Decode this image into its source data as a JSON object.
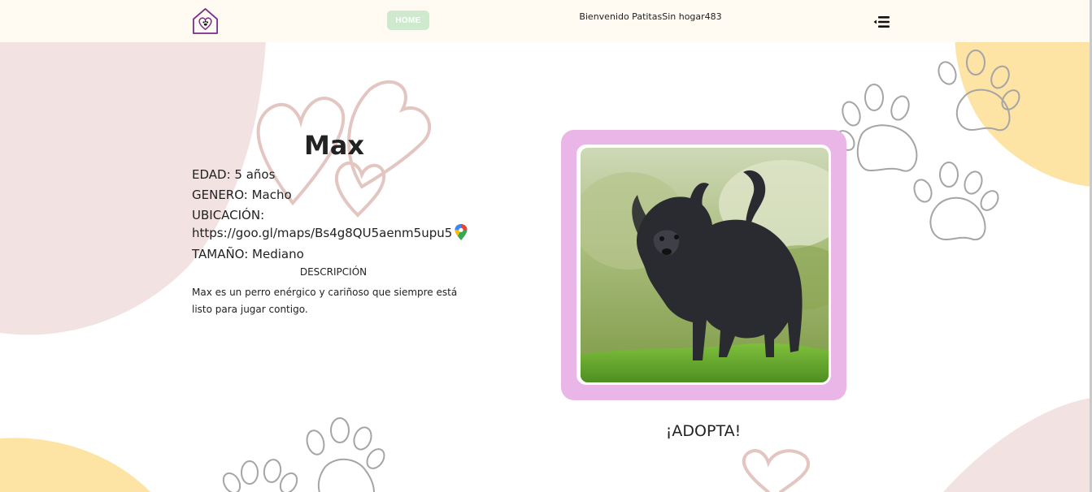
{
  "nav": {
    "home_label": "HOME",
    "welcome_text": "Bienvenido PatitasSin hogar483",
    "logo_icon": "house-heart-paw-logo-icon",
    "menu_icon": "menu-collapse-icon"
  },
  "pet": {
    "name": "Max",
    "age": "EDAD: 5 años",
    "gender": "GENERO: Macho",
    "location_label": "UBICACIÓN:",
    "location_url": "https://goo.gl/maps/Bs4g8QU5aenm5upu5",
    "size": "TAMAÑO: Mediano",
    "description_title": "DESCRIPCIÓN",
    "description": "Max es un perro enérgico y cariñoso que siempre está listo para jugar contigo."
  },
  "actions": {
    "adopt_label": "¡ADOPTA!"
  },
  "colors": {
    "nav_bg": "#fffbf3",
    "home_button": "#cfe9cf",
    "photo_frame": "#eab6e8",
    "blob_pink": "#f2e2e2",
    "blob_yellow": "#fde3a4",
    "heart_stroke": "#e3c6c2",
    "paw_stroke": "#a5a5a5"
  }
}
